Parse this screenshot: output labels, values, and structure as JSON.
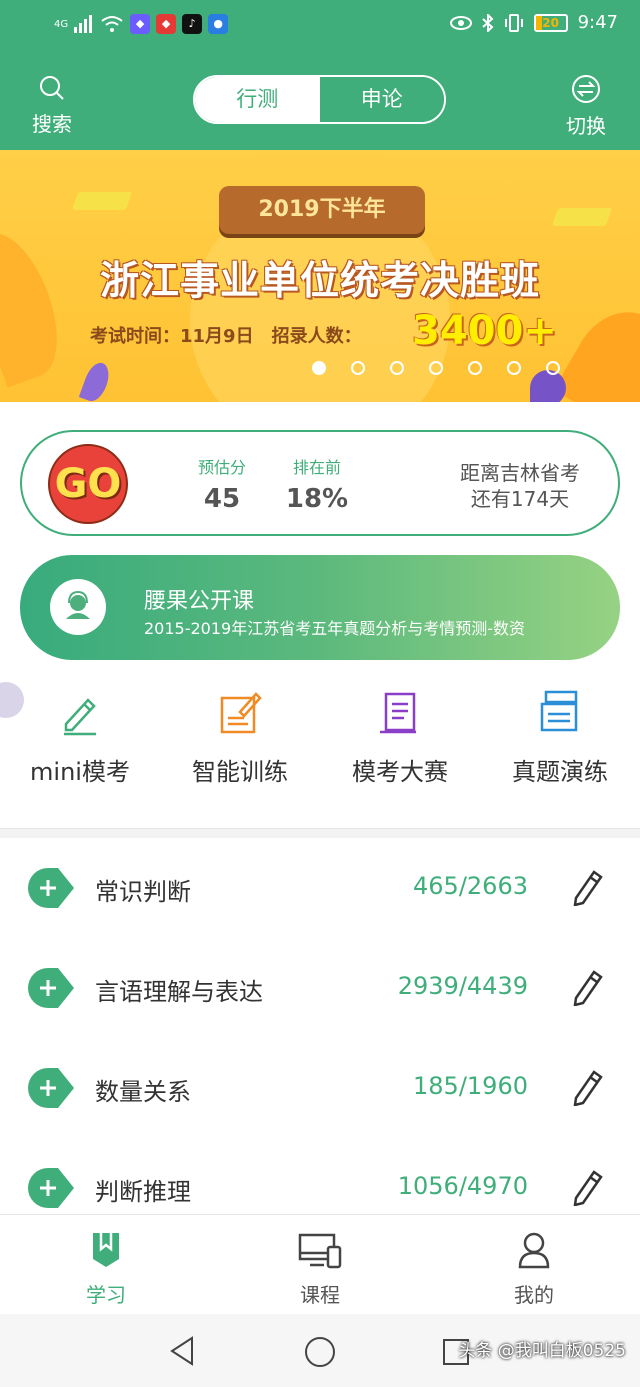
{
  "status_bar": {
    "network": "4G",
    "time": "9:47",
    "battery": "20",
    "colors": {
      "battery": "#f4b400"
    }
  },
  "header": {
    "search_label": "搜索",
    "switch_label": "切换",
    "tabs": [
      {
        "label": "行测",
        "active": true
      },
      {
        "label": "申论",
        "active": false
      }
    ]
  },
  "banner": {
    "tag": "2019下半年",
    "title": "浙江事业单位统考决胜班",
    "info": "考试时间：11月9日　招录人数：",
    "highlight": "3400+",
    "page_count": 7,
    "active_page": 1
  },
  "score_card": {
    "avatar_text": "GO",
    "stats": [
      {
        "key": "预估分",
        "value": "45"
      },
      {
        "key": "排在前",
        "value": "18%"
      }
    ],
    "countdown_line1": "距离吉林省考",
    "countdown_line2": "还有174天"
  },
  "course": {
    "title": "腰果公开课",
    "subtitle": "2015-2019年江苏省考五年真题分析与考情预测-数资"
  },
  "quick_menu": [
    {
      "label": "mini模考",
      "icon": "pencil-icon"
    },
    {
      "label": "智能训练",
      "icon": "note-edit-icon"
    },
    {
      "label": "模考大赛",
      "icon": "scroll-icon"
    },
    {
      "label": "真题演练",
      "icon": "stack-icon"
    }
  ],
  "subjects": [
    {
      "name": "常识判断",
      "progress": "465/2663"
    },
    {
      "name": "言语理解与表达",
      "progress": "2939/4439"
    },
    {
      "name": "数量关系",
      "progress": "185/1960"
    },
    {
      "name": "判断推理",
      "progress": "1056/4970"
    }
  ],
  "bottom_nav": [
    {
      "label": "学习",
      "active": true
    },
    {
      "label": "课程",
      "active": false
    },
    {
      "label": "我的",
      "active": false
    }
  ],
  "watermark": "头条 @我叫白板0525",
  "colors": {
    "primary": "#3fae7a",
    "banner": "#ffc233"
  }
}
